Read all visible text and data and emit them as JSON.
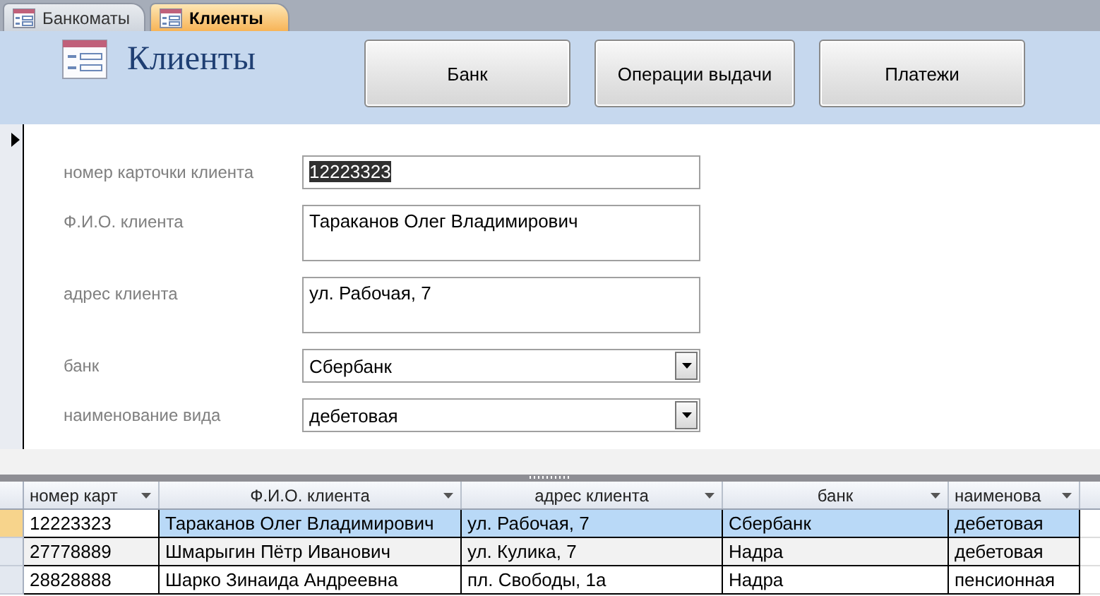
{
  "tabs": [
    {
      "label": "Банкоматы",
      "selected": false
    },
    {
      "label": "Клиенты",
      "selected": true
    }
  ],
  "form": {
    "title": "Клиенты",
    "buttons": [
      "Банк",
      "Операции выдачи",
      "Платежи"
    ],
    "fields": [
      {
        "kind": "text",
        "label": "номер карточки клиента",
        "value": "12223323",
        "selected": true
      },
      {
        "kind": "memo",
        "label": "Ф.И.О. клиента",
        "value": "Тараканов Олег Владимирович",
        "selected": false
      },
      {
        "kind": "memo",
        "label": "адрес клиента",
        "value": "ул. Рабочая, 7",
        "selected": false
      },
      {
        "kind": "combo",
        "label": "банк",
        "value": "Сбербанк",
        "selected": false
      },
      {
        "kind": "combo",
        "label": "наименование вида",
        "value": "дебетовая",
        "selected": false
      }
    ]
  },
  "table": {
    "columns": [
      "номер карт",
      "Ф.И.О. клиента",
      "адрес клиента",
      "банк",
      "наименова"
    ],
    "rows": [
      {
        "selected": true,
        "cells": [
          "12223323",
          "Тараканов Олег Владимирович",
          "ул. Рабочая, 7",
          "Сбербанк",
          "дебетовая"
        ]
      },
      {
        "selected": false,
        "cells": [
          "27778889",
          "Шмарыгин Пётр Иванович",
          "ул. Кулика, 7",
          "Надра",
          "дебетовая"
        ]
      },
      {
        "selected": false,
        "cells": [
          "28828888",
          "Шарко Зинаида Андреевна",
          "пл. Свободы, 1а",
          "Надра",
          "пенсионная"
        ]
      }
    ]
  }
}
